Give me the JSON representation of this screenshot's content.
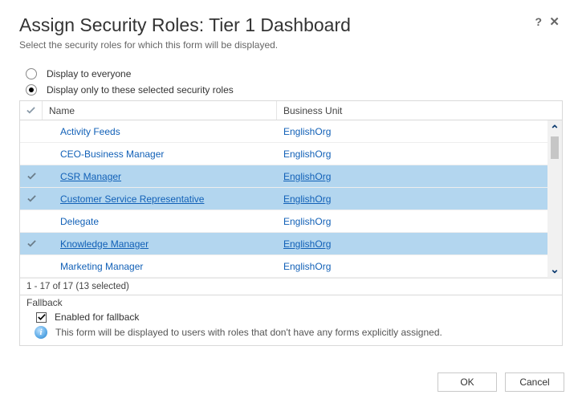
{
  "header": {
    "title": "Assign Security Roles: Tier 1 Dashboard",
    "subtitle": "Select the security roles for which this form will be displayed.",
    "help_label": "?",
    "close_label": "✕"
  },
  "display_options": {
    "everyone": "Display to everyone",
    "selected_only": "Display only to these selected security roles",
    "selected": "selected_only"
  },
  "table": {
    "headers": {
      "name": "Name",
      "business_unit": "Business Unit"
    },
    "rows": [
      {
        "name": "Activity Feeds",
        "bu": "EnglishOrg",
        "selected": false
      },
      {
        "name": "CEO-Business Manager",
        "bu": "EnglishOrg",
        "selected": false
      },
      {
        "name": "CSR Manager",
        "bu": "EnglishOrg",
        "selected": true
      },
      {
        "name": "Customer Service Representative",
        "bu": "EnglishOrg",
        "selected": true
      },
      {
        "name": "Delegate",
        "bu": "EnglishOrg",
        "selected": false
      },
      {
        "name": "Knowledge Manager",
        "bu": "EnglishOrg",
        "selected": true
      },
      {
        "name": "Marketing Manager",
        "bu": "EnglishOrg",
        "selected": false
      }
    ],
    "footer_count": "1 - 17 of 17 (13 selected)"
  },
  "fallback": {
    "section_label": "Fallback",
    "enabled_label": "Enabled for fallback",
    "enabled": true,
    "info_text": "This form will be displayed to users with roles that don't have any forms explicitly assigned."
  },
  "buttons": {
    "ok": "OK",
    "cancel": "Cancel"
  }
}
